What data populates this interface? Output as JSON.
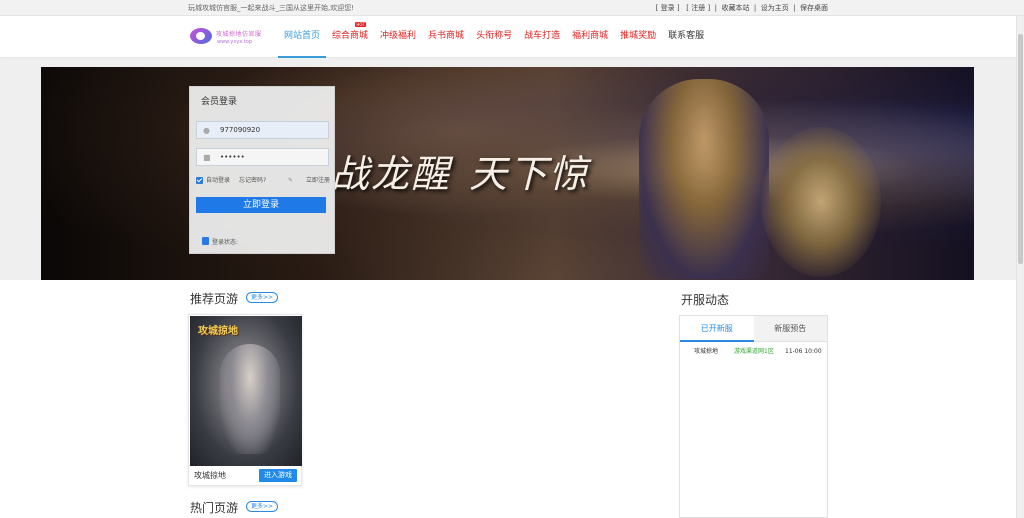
{
  "topbar": {
    "welcome": "玩城攻城仿官服_一起来战斗_三国从这里开始,欢迎您!",
    "links": [
      {
        "text": "登录",
        "bracket": true
      },
      {
        "text": "注册",
        "bracket": true
      },
      {
        "text": "收藏本站"
      },
      {
        "text": "设为主页"
      },
      {
        "text": "保存桌面"
      }
    ]
  },
  "logo": {
    "title": "攻城掠地仿官服",
    "url": "www.yxyx.top"
  },
  "nav": {
    "items": [
      {
        "label": "网站首页",
        "state": "active"
      },
      {
        "label": "综合商城",
        "badge": "HOT"
      },
      {
        "label": "冲级福利"
      },
      {
        "label": "兵书商城"
      },
      {
        "label": "头衔称号"
      },
      {
        "label": "战车打造"
      },
      {
        "label": "福利商城"
      },
      {
        "label": "推城奖励"
      },
      {
        "label": "联系客服",
        "state": "plain"
      }
    ]
  },
  "banner": {
    "slogan_part1": "战龙醒",
    "slogan_part2": "天下惊"
  },
  "login": {
    "title": "会员登录",
    "username": "977090920",
    "password": "••••••",
    "auto_login": "自动登录",
    "forgot": "忘记密码?",
    "register": "立即注册",
    "submit": "立即登录",
    "status": "登录状态:"
  },
  "recommend": {
    "title": "推荐页游",
    "more": "更多>>",
    "games": [
      {
        "name": "攻城掠地",
        "cover_title": "攻城掠地",
        "button": "进入游戏"
      }
    ]
  },
  "hot": {
    "title": "热门页游",
    "more": "更多>>"
  },
  "servers": {
    "title": "开服动态",
    "tabs": [
      "已开新服",
      "新服预告"
    ],
    "rows": [
      {
        "game": "攻城掠地",
        "server": "游戏渠道网1区",
        "time": "11-06 10:00"
      }
    ]
  }
}
